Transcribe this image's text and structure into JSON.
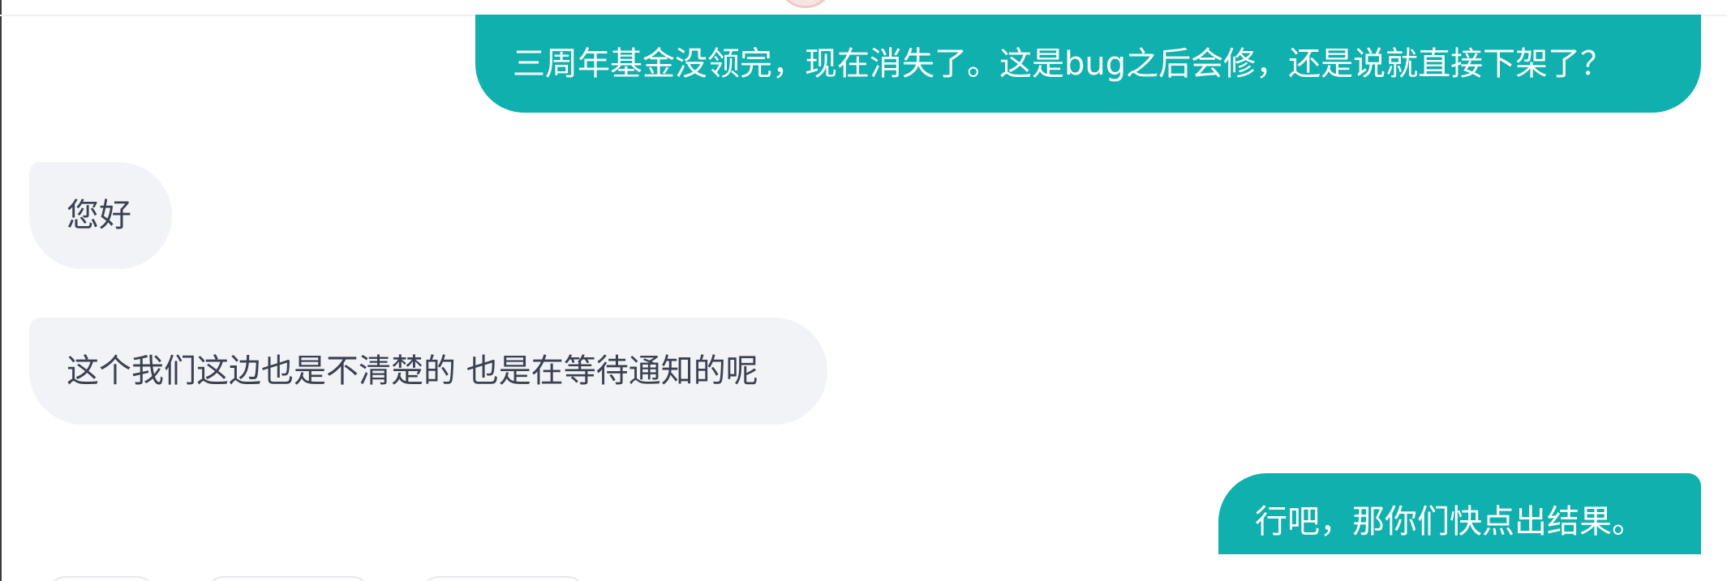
{
  "chat": {
    "messages": [
      {
        "sender": "user",
        "text": "三周年基金没领完，现在消失了。这是bug之后会修，还是说就直接下架了？"
      },
      {
        "sender": "agent",
        "text": "您好"
      },
      {
        "sender": "agent",
        "text": "这个我们这边也是不清楚的 也是在等待通知的呢"
      },
      {
        "sender": "user",
        "text": "行吧，那你们快点出结果。"
      }
    ]
  },
  "colors": {
    "outgoing_bubble": "#0fb0ae",
    "incoming_bubble": "#f1f3f6",
    "incoming_text": "#3b4150",
    "outgoing_text": "#ffffff"
  }
}
